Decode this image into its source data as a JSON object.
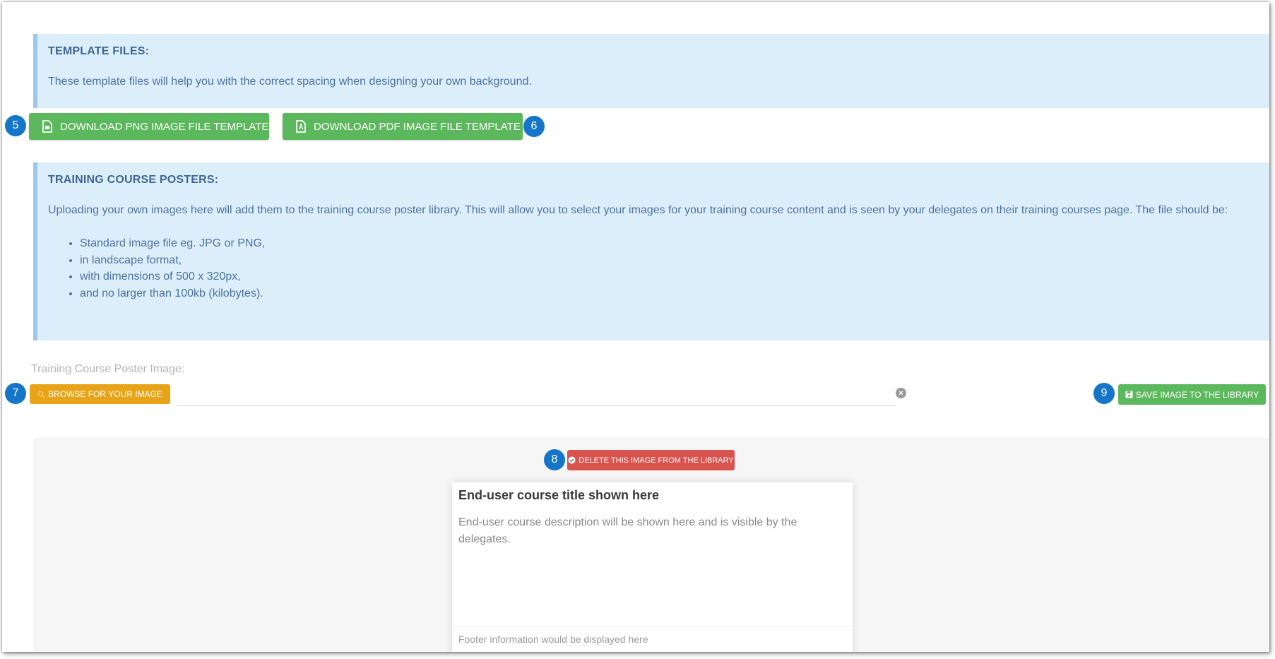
{
  "template_files": {
    "heading": "TEMPLATE FILES:",
    "text": "These template files will help you with the correct spacing when designing your own background."
  },
  "buttons": {
    "download_png": "DOWNLOAD PNG IMAGE FILE TEMPLATE",
    "download_pdf": "DOWNLOAD PDF IMAGE FILE TEMPLATE",
    "browse": "BROWSE FOR YOUR IMAGE",
    "save": "SAVE IMAGE TO THE LIBRARY",
    "delete": "DELETE THIS IMAGE FROM THE LIBRARY"
  },
  "badges": {
    "b5": "5",
    "b6": "6",
    "b7": "7",
    "b8": "8",
    "b9": "9"
  },
  "posters": {
    "heading": "TRAINING COURSE POSTERS:",
    "text": "Uploading your own images here will add them to the training course poster library. This will allow you to select your images for your training course content and is seen by your delegates on their training courses page. The file should be:",
    "requirements": [
      "Standard image file eg. JPG or PNG,",
      "in landscape format,",
      "with dimensions of 500 x 320px,",
      "and no larger than 100kb (kilobytes)."
    ]
  },
  "upload": {
    "label": "Training Course Poster Image:",
    "value": "",
    "clear_glyph": "×"
  },
  "preview_card": {
    "title": "End-user course title shown here",
    "description": "End-user course description will be shown here and is visible by the delegates.",
    "footer": "Footer information would be displayed here"
  },
  "colors": {
    "info_bg": "#ddeefb",
    "success": "#5cb85c",
    "warning": "#e8a317",
    "danger": "#d9534f",
    "badge": "#1576c9"
  },
  "icons": {
    "png": "file-image-icon",
    "pdf": "file-pdf-icon",
    "browse": "search-icon",
    "save": "floppy-disk-icon",
    "delete": "check-circle-icon",
    "clear": "close-circle-icon"
  }
}
